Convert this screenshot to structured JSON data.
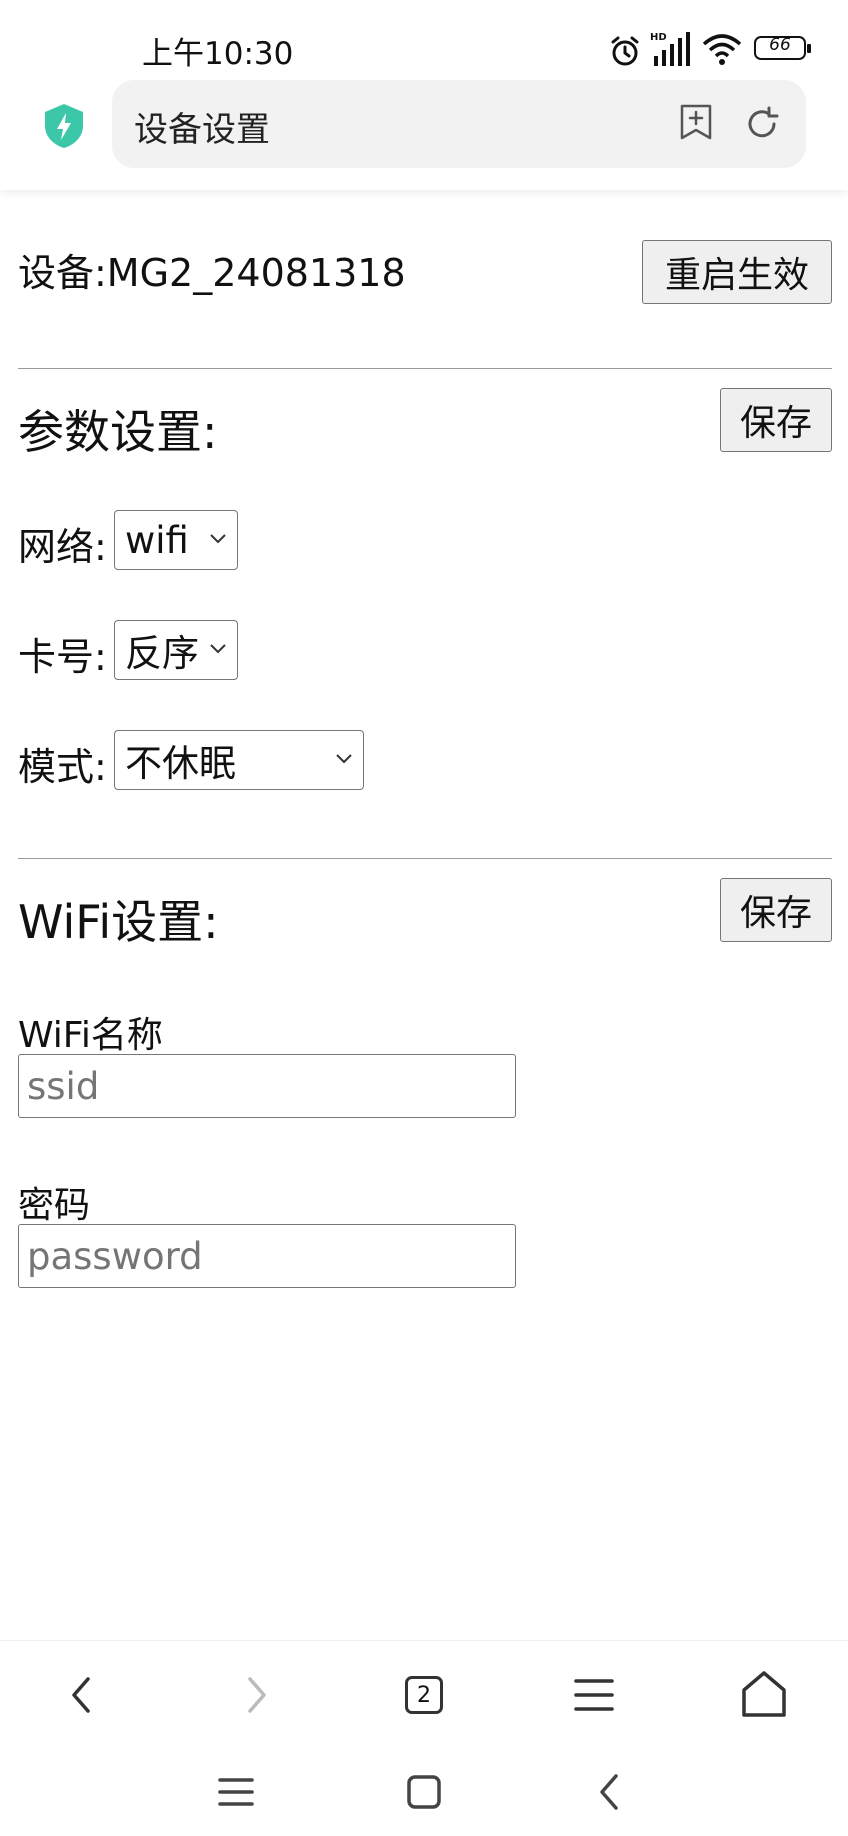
{
  "status_bar": {
    "time": "上午10:30",
    "battery": "66",
    "icons": [
      "alarm-icon",
      "hd-signal-icon",
      "wifi-icon",
      "battery-icon"
    ]
  },
  "browser": {
    "title": "设备设置",
    "icons": [
      "shield-icon",
      "bookmark-add-icon",
      "reload-icon"
    ],
    "accent_color": "#3cc7a8"
  },
  "device": {
    "label": "设备:MG2_24081318",
    "restart_label": "重启生效"
  },
  "params": {
    "title": "参数设置:",
    "save_label": "保存",
    "network_label": "网络:",
    "network_value": "wifi",
    "card_label": "卡号:",
    "card_value": "反序",
    "mode_label": "模式:",
    "mode_value": "不休眠"
  },
  "wifi": {
    "title": "WiFi设置:",
    "save_label": "保存",
    "ssid_label": "WiFi名称",
    "ssid_placeholder": "ssid",
    "password_label": "密码",
    "password_placeholder": "password"
  },
  "bottom_nav": {
    "tab_count": "2",
    "icons": [
      "back-icon",
      "forward-icon",
      "tabs-icon",
      "menu-icon",
      "home-icon"
    ]
  },
  "system_nav": {
    "icons": [
      "recents-icon",
      "home-square-icon",
      "back-triangle-icon"
    ]
  }
}
